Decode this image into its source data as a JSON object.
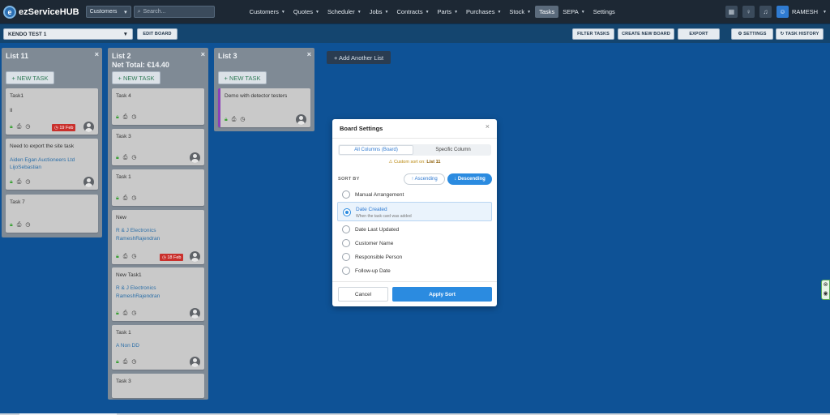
{
  "app": {
    "logo_letter": "e",
    "logo_text": "ezServiceHUB"
  },
  "topnav": {
    "customer_select": "Customers",
    "search_placeholder": "Search...",
    "menu": [
      {
        "label": "Customers",
        "caret": true
      },
      {
        "label": "Quotes",
        "caret": true
      },
      {
        "label": "Scheduler",
        "caret": true
      },
      {
        "label": "Jobs",
        "caret": true
      },
      {
        "label": "Contracts",
        "caret": true
      },
      {
        "label": "Parts",
        "caret": true
      },
      {
        "label": "Purchases",
        "caret": true
      },
      {
        "label": "Stock",
        "caret": true
      },
      {
        "label": "Tasks",
        "caret": false,
        "active": true
      },
      {
        "label": "SEPA",
        "caret": true
      },
      {
        "label": "Settings",
        "caret": false
      }
    ],
    "user_name": "RAMESH"
  },
  "toolbar": {
    "board_name": "KENDO TEST 1",
    "edit_board": "EDIT BOARD",
    "filter_tasks": "FILTER TASKS",
    "create_new_board": "CREATE NEW BOARD",
    "export": "EXPORT",
    "settings": "⚙ SETTINGS",
    "task_history": "↻ TASK HISTORY"
  },
  "lists": [
    {
      "title": "List 11",
      "new_task": "+ NEW TASK",
      "cards": [
        {
          "title": "Task1",
          "lines": [
            "II"
          ],
          "date": "19 Feb",
          "avatar": true
        },
        {
          "title": "Need to export the site task",
          "lines": [
            "Aiden Egan Auctioneers Ltd",
            "LijoSebastian"
          ],
          "avatar": true
        },
        {
          "title": "Task 7",
          "lines": []
        }
      ]
    },
    {
      "title": "List 2",
      "subtitle": "Net Total: €14.40",
      "new_task": "+ NEW TASK",
      "cards": [
        {
          "title": "Task 4",
          "lines": []
        },
        {
          "title": "Task 3",
          "lines": [],
          "avatar": true
        },
        {
          "title": "Task 1",
          "lines": []
        },
        {
          "title": "New",
          "lines": [
            "R & J Electronics",
            "RameshRajendran"
          ],
          "date": "18 Feb",
          "avatar": true
        },
        {
          "title": "New Task1",
          "lines": [
            "R & J Electronics",
            "RameshRajendran"
          ],
          "avatar": true
        },
        {
          "title": "Task 1",
          "lines": [
            "A Non DD"
          ],
          "avatar": true
        },
        {
          "title": "Task 3",
          "lines": []
        }
      ]
    },
    {
      "title": "List 3",
      "new_task": "+ NEW TASK",
      "cards": [
        {
          "title": "Demo with detector testers",
          "lines": [],
          "avatar": true
        }
      ]
    }
  ],
  "add_list": "+ Add Another List",
  "modal": {
    "title": "Board Settings",
    "close": "×",
    "tabs": [
      "All Columns (Board)",
      "Specific Column"
    ],
    "custom_sort_prefix": "⚠ Custom sort on:",
    "custom_sort_list": "List 11",
    "sort_by_label": "SORT BY",
    "ascending": "↑ Ascending",
    "descending": "↓ Descending",
    "options": [
      {
        "label": "Manual Arrangement"
      },
      {
        "label": "Date Created",
        "sub": "When the task card was added",
        "selected": true
      },
      {
        "label": "Date Last Updated"
      },
      {
        "label": "Customer Name"
      },
      {
        "label": "Responsible Person"
      },
      {
        "label": "Follow-up Date"
      }
    ],
    "cancel": "Cancel",
    "apply": "Apply Sort"
  },
  "icons": {
    "lock": "lock-icon",
    "print": "printer-icon",
    "clock": "clock-icon"
  },
  "colors": {
    "background": "#0e5296",
    "nav": "#1d2834",
    "accent": "#2b8be0",
    "date_badge": "#c9302c",
    "lock_green": "#3aa035"
  }
}
